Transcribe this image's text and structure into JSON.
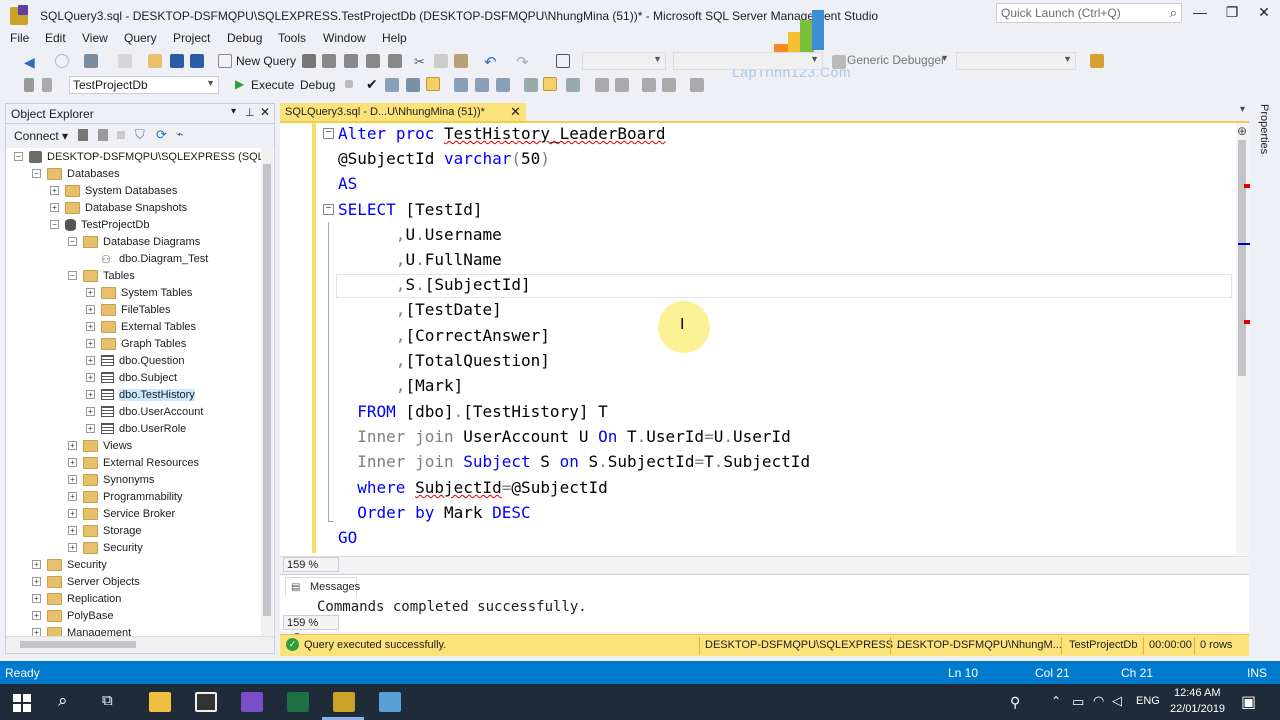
{
  "window": {
    "title": "SQLQuery3.sql - DESKTOP-DSFMQPU\\SQLEXPRESS.TestProjectDb (DESKTOP-DSFMQPU\\NhungMina (51))* - Microsoft SQL Server Management Studio",
    "quick_launch_placeholder": "Quick Launch (Ctrl+Q)",
    "minimize": "—",
    "maximize": "❐",
    "close": "✕",
    "watermark": "LapTrinh123.Com"
  },
  "menu": [
    "File",
    "Edit",
    "View",
    "Query",
    "Project",
    "Debug",
    "Tools",
    "Window",
    "Help"
  ],
  "toolbar1": {
    "new_query": "New Query",
    "solution_config": "Generic Debugger"
  },
  "toolbar2": {
    "database": "TestProjectDb",
    "execute": "Execute",
    "debug": "Debug"
  },
  "object_explorer": {
    "title": "Object Explorer",
    "connect": "Connect",
    "nodes": [
      {
        "label": "DESKTOP-DSFMQPU\\SQLEXPRESS (SQL Se",
        "exp": "−"
      },
      {
        "label": "Databases",
        "exp": "−"
      },
      {
        "label": "System Databases",
        "exp": "+"
      },
      {
        "label": "Database Snapshots",
        "exp": "+"
      },
      {
        "label": "TestProjectDb",
        "exp": "−"
      },
      {
        "label": "Database Diagrams",
        "exp": "−"
      },
      {
        "label": "dbo.Diagram_Test",
        "exp": ""
      },
      {
        "label": "Tables",
        "exp": "−"
      },
      {
        "label": "System Tables",
        "exp": "+"
      },
      {
        "label": "FileTables",
        "exp": "+"
      },
      {
        "label": "External Tables",
        "exp": "+"
      },
      {
        "label": "Graph Tables",
        "exp": "+"
      },
      {
        "label": "dbo.Question",
        "exp": "+"
      },
      {
        "label": "dbo.Subject",
        "exp": "+"
      },
      {
        "label": "dbo.TestHistory",
        "exp": "+"
      },
      {
        "label": "dbo.UserAccount",
        "exp": "+"
      },
      {
        "label": "dbo.UserRole",
        "exp": "+"
      },
      {
        "label": "Views",
        "exp": "+"
      },
      {
        "label": "External Resources",
        "exp": "+"
      },
      {
        "label": "Synonyms",
        "exp": "+"
      },
      {
        "label": "Programmability",
        "exp": "+"
      },
      {
        "label": "Service Broker",
        "exp": "+"
      },
      {
        "label": "Storage",
        "exp": "+"
      },
      {
        "label": "Security",
        "exp": "+"
      },
      {
        "label": "Security",
        "exp": "+"
      },
      {
        "label": "Server Objects",
        "exp": "+"
      },
      {
        "label": "Replication",
        "exp": "+"
      },
      {
        "label": "PolyBase",
        "exp": "+"
      },
      {
        "label": "Management",
        "exp": "+"
      }
    ]
  },
  "editor": {
    "tab_label": "SQLQuery3.sql - D...U\\NhungMina (51))*",
    "zoom": "159 %",
    "lines": [
      "Alter proc TestHistory_LeaderBoard",
      "@SubjectId varchar(50)",
      "AS",
      "SELECT [TestId]",
      ",U.Username",
      ",U.FullName",
      ",S.[SubjectId]",
      ",[TestDate]",
      ",[CorrectAnswer]",
      ",[TotalQuestion]",
      ",[Mark]",
      "FROM [dbo].[TestHistory] T",
      "Inner join UserAccount U On T.UserId=U.UserId",
      "Inner join Subject S on S.SubjectId=T.SubjectId",
      "where SubjectId=@SubjectId",
      "Order by Mark DESC",
      "GO"
    ]
  },
  "messages": {
    "tab": "Messages",
    "text": "Commands completed successfully.",
    "zoom": "159 %"
  },
  "query_status": {
    "message": "Query executed successfully.",
    "server": "DESKTOP-DSFMQPU\\SQLEXPRESS ...",
    "user": "DESKTOP-DSFMQPU\\NhungM...",
    "database": "TestProjectDb",
    "elapsed": "00:00:00",
    "rows": "0 rows"
  },
  "properties_label": "Properties",
  "statusbar": {
    "state": "Ready",
    "line": "Ln 10",
    "col": "Col 21",
    "ch": "Ch 21",
    "mode": "INS"
  },
  "taskbar": {
    "lang": "ENG",
    "time": "12:46 AM",
    "date": "22/01/2019"
  },
  "colors": {
    "accent": "#007acc",
    "tab_yellow": "#fbe27a",
    "keyword": "#0000ff",
    "gray_keyword": "#808080",
    "function": "#ff00ff"
  }
}
